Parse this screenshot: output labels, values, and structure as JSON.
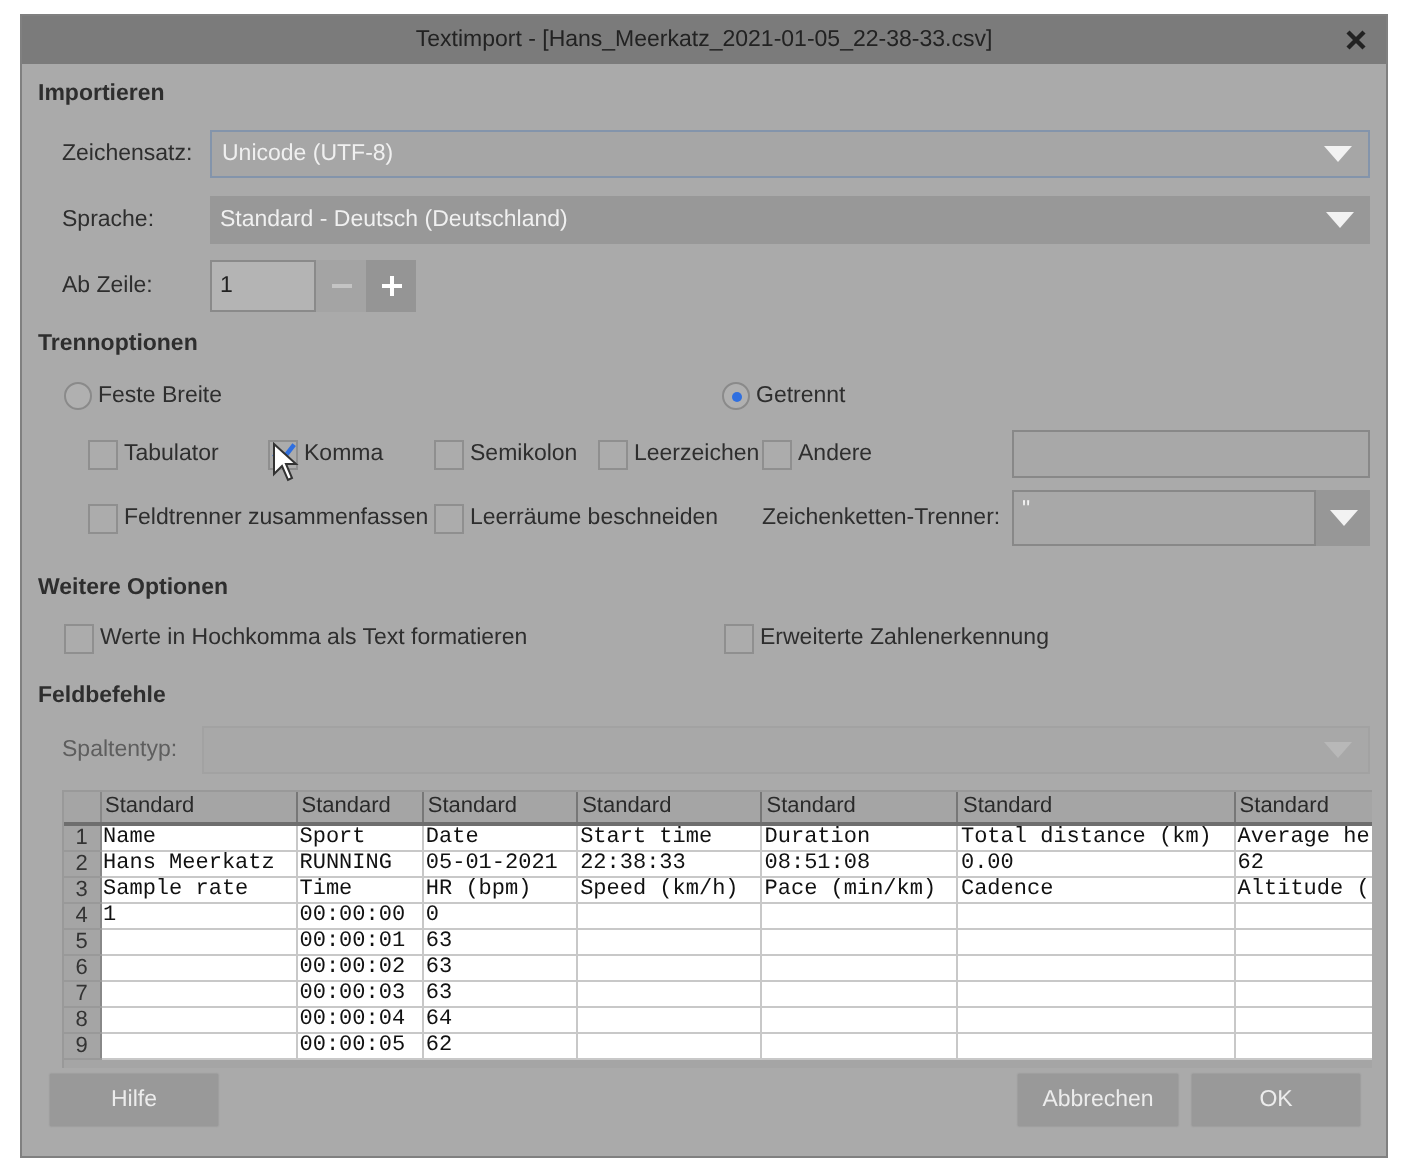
{
  "window": {
    "title": "Textimport - [Hans_Meerkatz_2021-01-05_22-38-33.csv]"
  },
  "import": {
    "heading": "Importieren",
    "charset": {
      "label": "Zeichensatz:",
      "value": "Unicode (UTF-8)",
      "focused": true
    },
    "language": {
      "label": "Sprache:",
      "value": "Standard - Deutsch (Deutschland)",
      "focused": false
    },
    "from_row": {
      "label": "Ab Zeile:",
      "value": "1",
      "minus_disabled": true
    }
  },
  "separator_options": {
    "heading": "Trennoptionen",
    "radios": [
      {
        "label": "Feste Breite",
        "selected": false
      },
      {
        "label": "Getrennt",
        "selected": true
      }
    ],
    "separators": [
      {
        "label": "Tabulator",
        "checked": false
      },
      {
        "label": "Komma",
        "checked": true
      },
      {
        "label": "Semikolon",
        "checked": false
      },
      {
        "label": "Leerzeichen",
        "checked": false
      },
      {
        "label": "Andere",
        "checked": false
      }
    ],
    "options": [
      {
        "label": "Feldtrenner zusammenfassen",
        "checked": false
      },
      {
        "label": "Leerräume beschneiden",
        "checked": false
      }
    ],
    "string_delimiter": {
      "label": "Zeichenketten-Trenner:",
      "value": "\""
    }
  },
  "further_options": {
    "heading": "Weitere Optionen",
    "checkboxes": [
      {
        "label": "Werte in Hochkomma als Text formatieren",
        "checked": false
      },
      {
        "label": "Erweiterte Zahlenerkennung",
        "checked": false
      }
    ]
  },
  "field_commands": {
    "heading": "Feldbefehle",
    "column_type": {
      "label": "Spaltentyp:",
      "disabled": true
    }
  },
  "table": {
    "column_types": [
      "Standard",
      "Standard",
      "Standard",
      "Standard",
      "Standard",
      "Standard",
      "Standard"
    ],
    "rows": [
      {
        "number": "1",
        "cells": [
          "Name",
          "Sport",
          "Date",
          "Start time",
          "Duration",
          "Total distance (km)",
          "Average he"
        ]
      },
      {
        "number": "2",
        "cells": [
          "Hans Meerkatz",
          "RUNNING",
          "05-01-2021",
          "22:38:33",
          "08:51:08",
          "0.00",
          "62"
        ]
      },
      {
        "number": "3",
        "cells": [
          "Sample rate",
          "Time",
          "HR (bpm)",
          "Speed (km/h)",
          "Pace (min/km)",
          "Cadence",
          "Altitude ("
        ]
      },
      {
        "number": "4",
        "cells": [
          "1",
          "00:00:00",
          "0",
          "",
          "",
          "",
          ""
        ]
      },
      {
        "number": "5",
        "cells": [
          "",
          "00:00:01",
          "63",
          "",
          "",
          "",
          ""
        ]
      },
      {
        "number": "6",
        "cells": [
          "",
          "00:00:02",
          "63",
          "",
          "",
          "",
          ""
        ]
      },
      {
        "number": "7",
        "cells": [
          "",
          "00:00:03",
          "63",
          "",
          "",
          "",
          ""
        ]
      },
      {
        "number": "8",
        "cells": [
          "",
          "00:00:04",
          "64",
          "",
          "",
          "",
          ""
        ]
      },
      {
        "number": "9",
        "cells": [
          "",
          "00:00:05",
          "62",
          "",
          "",
          "",
          ""
        ]
      }
    ]
  },
  "buttons": [
    {
      "label": "Hilfe",
      "kind": "help"
    },
    {
      "label": "Abbrechen",
      "kind": "cancel"
    },
    {
      "label": "OK",
      "kind": "ok"
    }
  ]
}
